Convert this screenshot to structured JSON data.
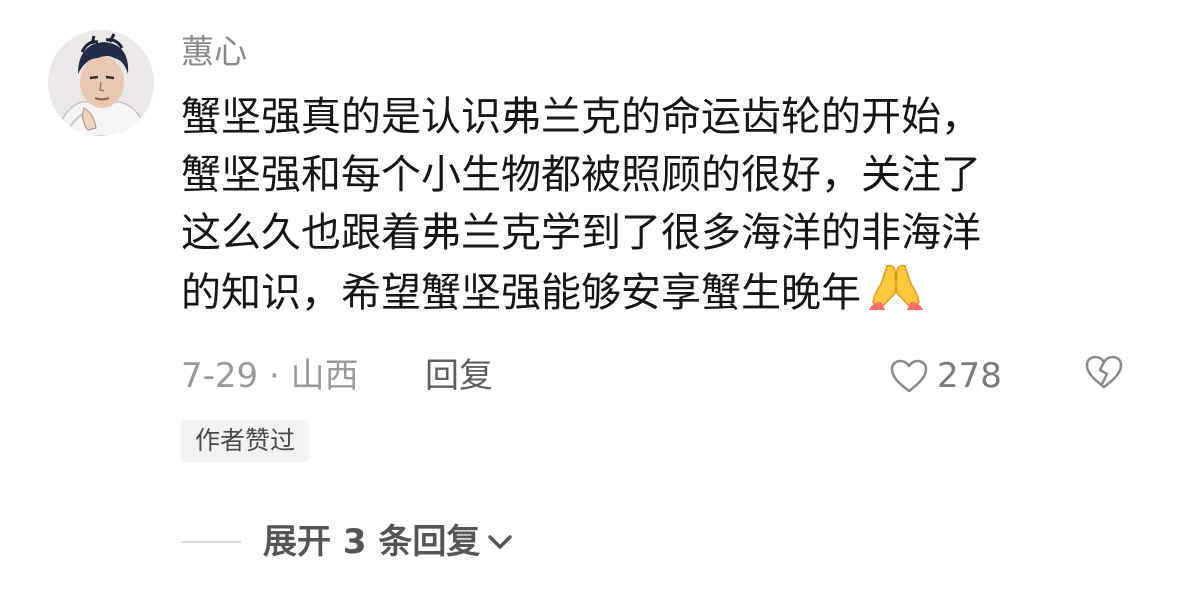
{
  "comment": {
    "username": "蕙心",
    "text_lines": [
      "蟹坚强真的是认识弗兰克的命运齿轮的开始，",
      "蟹坚强和每个小生物都被照顾的很好，关注了",
      "这么久也跟着弗兰克学到了很多海洋的非海洋",
      "的知识，希望蟹坚强能够安享蟹生晚年"
    ],
    "emoji": "folded-hands-emoji",
    "date_location": "7-29 · 山西",
    "reply_label": "回复",
    "like_count": "278",
    "author_badge": "作者赞过",
    "expand_label": "展开 3 条回复"
  },
  "colors": {
    "username": "#8a8a8a",
    "body_text": "#161616",
    "meta_text": "#9a9a9a",
    "badge_bg": "#f2f2f2"
  },
  "icons": {
    "like": "heart-outline-icon",
    "dislike": "broken-heart-outline-icon",
    "expand": "chevron-down-icon"
  }
}
